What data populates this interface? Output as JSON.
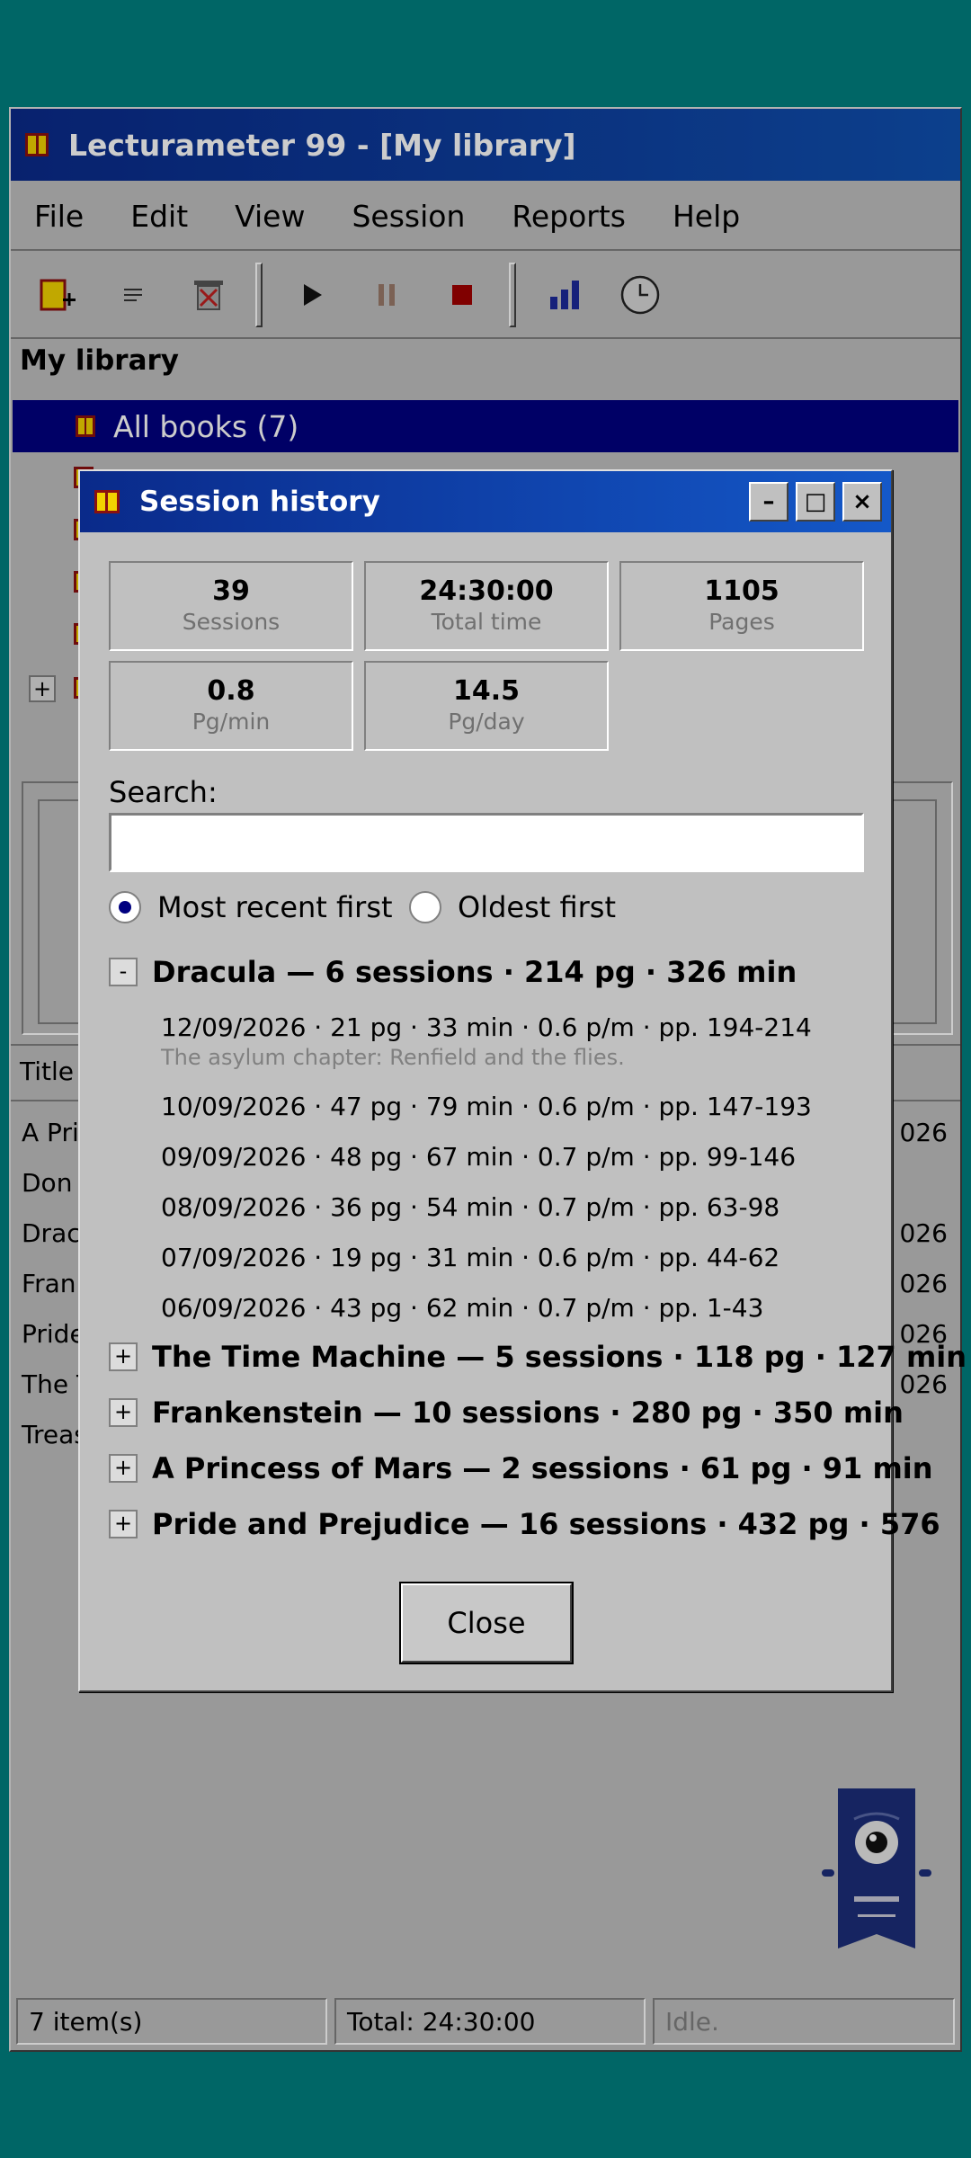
{
  "app": {
    "title": "Lecturameter 99 - [My library]",
    "menu": [
      "File",
      "Edit",
      "View",
      "Session",
      "Reports",
      "Help"
    ],
    "toolbar_icons": [
      "new-book-icon",
      "details-icon",
      "delete-book-icon",
      "play-icon",
      "pause-icon",
      "stop-icon",
      "chart-icon",
      "clock-icon"
    ]
  },
  "tree": {
    "heading": "My library",
    "selected": "All books (7)"
  },
  "list": {
    "header_title": "Title",
    "rows": [
      "A Prin",
      "Don C",
      "Dracu",
      "Frank",
      "Pride",
      "The T",
      "Treas"
    ],
    "dates": [
      "026",
      "",
      "026",
      "026",
      "026",
      "026",
      ""
    ]
  },
  "status": {
    "items": "7 item(s)",
    "total": "Total: 24:30:00",
    "state": "Idle."
  },
  "dialog": {
    "title": "Session history",
    "controls": {
      "minimize": "–",
      "maximize": "□",
      "close": "×"
    },
    "stats": [
      {
        "value": "39",
        "label": "Sessions"
      },
      {
        "value": "24:30:00",
        "label": "Total time"
      },
      {
        "value": "1105",
        "label": "Pages"
      },
      {
        "value": "0.8",
        "label": "Pg/min"
      },
      {
        "value": "14.5",
        "label": "Pg/day"
      }
    ],
    "search": {
      "label": "Search:",
      "value": "",
      "placeholder": ""
    },
    "sort": {
      "option_recent": "Most recent first",
      "option_oldest": "Oldest first",
      "selected": "Most recent first"
    },
    "groups": [
      {
        "toggle": "-",
        "title": "Dracula — 6 sessions · 214 pg · 326 min",
        "expanded": true,
        "sessions": [
          {
            "line": "12/09/2026 · 21 pg · 33 min · 0.6 p/m · pp. 194-214",
            "note": "The asylum chapter: Renfield and the flies."
          },
          {
            "line": "10/09/2026 · 47 pg · 79 min · 0.6 p/m · pp. 147-193"
          },
          {
            "line": "09/09/2026 · 48 pg · 67 min · 0.7 p/m · pp. 99-146"
          },
          {
            "line": "08/09/2026 · 36 pg · 54 min · 0.7 p/m · pp. 63-98"
          },
          {
            "line": "07/09/2026 · 19 pg · 31 min · 0.6 p/m · pp. 44-62"
          },
          {
            "line": "06/09/2026 · 43 pg · 62 min · 0.7 p/m · pp. 1-43"
          }
        ]
      },
      {
        "toggle": "+",
        "title": "The Time Machine — 5 sessions · 118 pg · 127 min",
        "expanded": false
      },
      {
        "toggle": "+",
        "title": "Frankenstein — 10 sessions · 280 pg · 350 min",
        "expanded": false
      },
      {
        "toggle": "+",
        "title": "A Princess of Mars — 2 sessions · 61 pg · 91 min",
        "expanded": false
      },
      {
        "toggle": "+",
        "title": "Pride and Prejudice — 16 sessions · 432 pg · 576",
        "expanded": false
      }
    ],
    "close_label": "Close"
  },
  "colors": {
    "desktop": "#008080",
    "titlebar": "#0a2a8a",
    "selection": "#000080",
    "face": "#c0c0c0"
  }
}
